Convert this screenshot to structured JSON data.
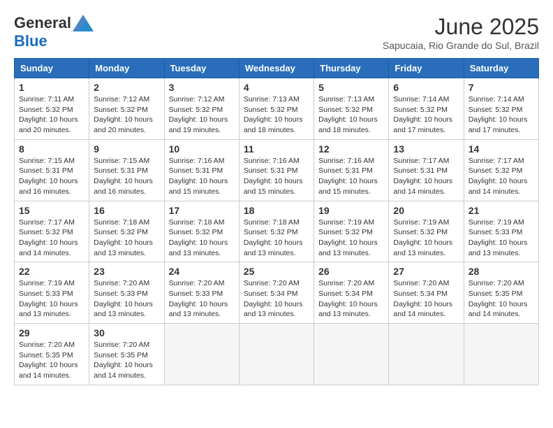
{
  "header": {
    "logo_general": "General",
    "logo_blue": "Blue",
    "month_title": "June 2025",
    "location": "Sapucaia, Rio Grande do Sul, Brazil"
  },
  "calendar": {
    "days_of_week": [
      "Sunday",
      "Monday",
      "Tuesday",
      "Wednesday",
      "Thursday",
      "Friday",
      "Saturday"
    ],
    "weeks": [
      [
        {
          "day": "",
          "empty": true
        },
        {
          "day": "",
          "empty": true
        },
        {
          "day": "",
          "empty": true
        },
        {
          "day": "",
          "empty": true
        },
        {
          "day": "",
          "empty": true
        },
        {
          "day": "",
          "empty": true
        },
        {
          "day": "",
          "empty": true
        }
      ],
      [
        {
          "day": "1",
          "sunrise": "7:11 AM",
          "sunset": "5:32 PM",
          "daylight": "10 hours and 20 minutes."
        },
        {
          "day": "2",
          "sunrise": "7:12 AM",
          "sunset": "5:32 PM",
          "daylight": "10 hours and 20 minutes."
        },
        {
          "day": "3",
          "sunrise": "7:12 AM",
          "sunset": "5:32 PM",
          "daylight": "10 hours and 19 minutes."
        },
        {
          "day": "4",
          "sunrise": "7:13 AM",
          "sunset": "5:32 PM",
          "daylight": "10 hours and 18 minutes."
        },
        {
          "day": "5",
          "sunrise": "7:13 AM",
          "sunset": "5:32 PM",
          "daylight": "10 hours and 18 minutes."
        },
        {
          "day": "6",
          "sunrise": "7:14 AM",
          "sunset": "5:32 PM",
          "daylight": "10 hours and 17 minutes."
        },
        {
          "day": "7",
          "sunrise": "7:14 AM",
          "sunset": "5:32 PM",
          "daylight": "10 hours and 17 minutes."
        }
      ],
      [
        {
          "day": "8",
          "sunrise": "7:15 AM",
          "sunset": "5:31 PM",
          "daylight": "10 hours and 16 minutes."
        },
        {
          "day": "9",
          "sunrise": "7:15 AM",
          "sunset": "5:31 PM",
          "daylight": "10 hours and 16 minutes."
        },
        {
          "day": "10",
          "sunrise": "7:16 AM",
          "sunset": "5:31 PM",
          "daylight": "10 hours and 15 minutes."
        },
        {
          "day": "11",
          "sunrise": "7:16 AM",
          "sunset": "5:31 PM",
          "daylight": "10 hours and 15 minutes."
        },
        {
          "day": "12",
          "sunrise": "7:16 AM",
          "sunset": "5:31 PM",
          "daylight": "10 hours and 15 minutes."
        },
        {
          "day": "13",
          "sunrise": "7:17 AM",
          "sunset": "5:31 PM",
          "daylight": "10 hours and 14 minutes."
        },
        {
          "day": "14",
          "sunrise": "7:17 AM",
          "sunset": "5:32 PM",
          "daylight": "10 hours and 14 minutes."
        }
      ],
      [
        {
          "day": "15",
          "sunrise": "7:17 AM",
          "sunset": "5:32 PM",
          "daylight": "10 hours and 14 minutes."
        },
        {
          "day": "16",
          "sunrise": "7:18 AM",
          "sunset": "5:32 PM",
          "daylight": "10 hours and 13 minutes."
        },
        {
          "day": "17",
          "sunrise": "7:18 AM",
          "sunset": "5:32 PM",
          "daylight": "10 hours and 13 minutes."
        },
        {
          "day": "18",
          "sunrise": "7:18 AM",
          "sunset": "5:32 PM",
          "daylight": "10 hours and 13 minutes."
        },
        {
          "day": "19",
          "sunrise": "7:19 AM",
          "sunset": "5:32 PM",
          "daylight": "10 hours and 13 minutes."
        },
        {
          "day": "20",
          "sunrise": "7:19 AM",
          "sunset": "5:32 PM",
          "daylight": "10 hours and 13 minutes."
        },
        {
          "day": "21",
          "sunrise": "7:19 AM",
          "sunset": "5:33 PM",
          "daylight": "10 hours and 13 minutes."
        }
      ],
      [
        {
          "day": "22",
          "sunrise": "7:19 AM",
          "sunset": "5:33 PM",
          "daylight": "10 hours and 13 minutes."
        },
        {
          "day": "23",
          "sunrise": "7:20 AM",
          "sunset": "5:33 PM",
          "daylight": "10 hours and 13 minutes."
        },
        {
          "day": "24",
          "sunrise": "7:20 AM",
          "sunset": "5:33 PM",
          "daylight": "10 hours and 13 minutes."
        },
        {
          "day": "25",
          "sunrise": "7:20 AM",
          "sunset": "5:34 PM",
          "daylight": "10 hours and 13 minutes."
        },
        {
          "day": "26",
          "sunrise": "7:20 AM",
          "sunset": "5:34 PM",
          "daylight": "10 hours and 13 minutes."
        },
        {
          "day": "27",
          "sunrise": "7:20 AM",
          "sunset": "5:34 PM",
          "daylight": "10 hours and 14 minutes."
        },
        {
          "day": "28",
          "sunrise": "7:20 AM",
          "sunset": "5:35 PM",
          "daylight": "10 hours and 14 minutes."
        }
      ],
      [
        {
          "day": "29",
          "sunrise": "7:20 AM",
          "sunset": "5:35 PM",
          "daylight": "10 hours and 14 minutes."
        },
        {
          "day": "30",
          "sunrise": "7:20 AM",
          "sunset": "5:35 PM",
          "daylight": "10 hours and 14 minutes."
        },
        {
          "day": "",
          "empty": true
        },
        {
          "day": "",
          "empty": true
        },
        {
          "day": "",
          "empty": true
        },
        {
          "day": "",
          "empty": true
        },
        {
          "day": "",
          "empty": true
        }
      ]
    ]
  }
}
